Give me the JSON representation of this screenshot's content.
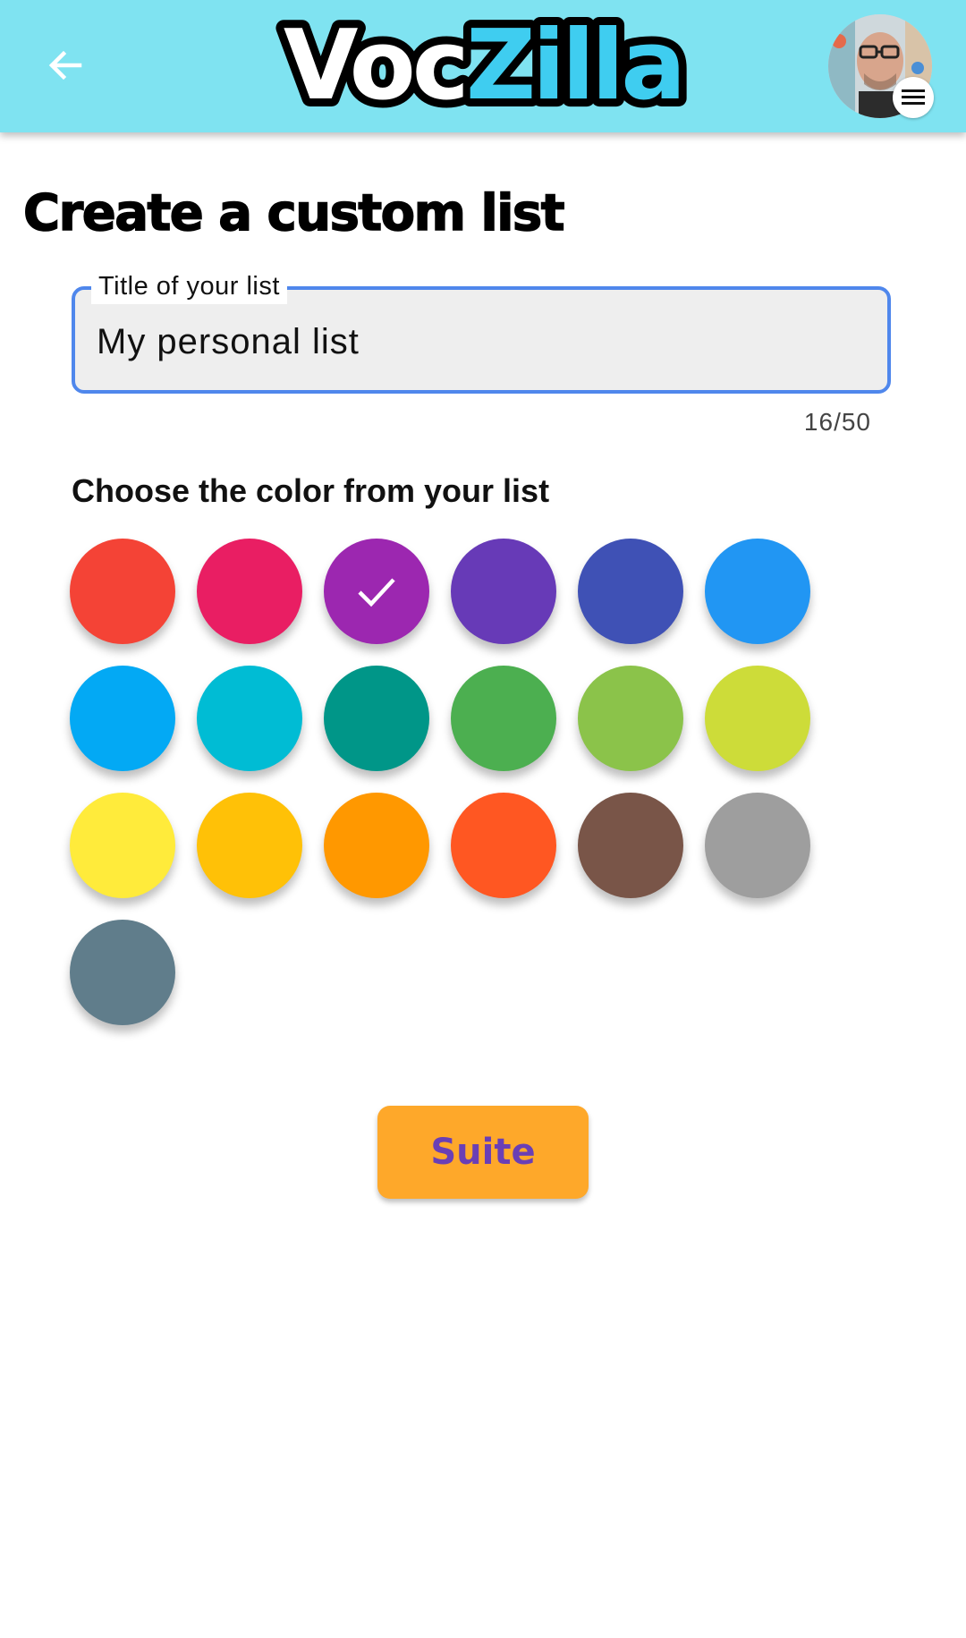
{
  "app": {
    "logo_part1": "Voc",
    "logo_part2": "Zilla",
    "bar_color": "#7fe3f1"
  },
  "header": {
    "back_icon": "arrow-left-icon",
    "avatar_icon": "user-avatar",
    "menu_icon": "hamburger-menu-icon"
  },
  "page": {
    "title": "Create a custom list"
  },
  "list_title_field": {
    "label": "Title of your list",
    "value": "My personal list",
    "counter": "16/50"
  },
  "color_section": {
    "title": "Choose the color from your list",
    "selected_index": 2,
    "colors": [
      "#f44336",
      "#e91e63",
      "#9c27b0",
      "#673ab7",
      "#3f51b5",
      "#2196f3",
      "#03a9f4",
      "#00bcd4",
      "#009688",
      "#4caf50",
      "#8bc34a",
      "#cddc39",
      "#ffeb3b",
      "#ffc107",
      "#ff9800",
      "#ff5722",
      "#795548",
      "#9e9e9e",
      "#607d8b"
    ]
  },
  "actions": {
    "next_label": "Suite"
  }
}
